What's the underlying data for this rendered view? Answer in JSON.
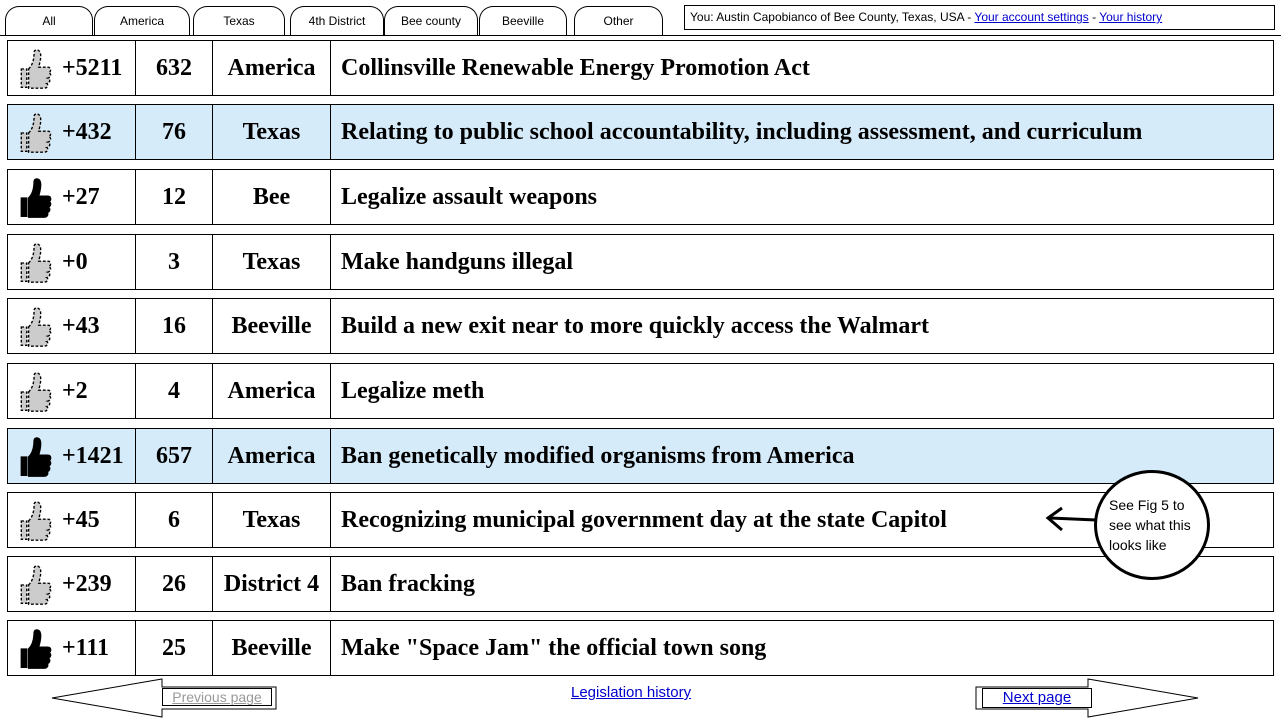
{
  "tabs": [
    "All",
    "America",
    "Texas",
    "4th District",
    "Bee county",
    "Beeville",
    "Other"
  ],
  "account": {
    "prefix": "You: Austin Capobianco of Bee County, Texas, USA - ",
    "settings_link": "Your account settings",
    "separator": " - ",
    "history_link": "Your history"
  },
  "rows": [
    {
      "score": "+5211",
      "count": "632",
      "region": "America",
      "title": "Collinsville Renewable Energy Promotion Act",
      "voted": false,
      "highlight": false
    },
    {
      "score": "+432",
      "count": "76",
      "region": "Texas",
      "title": "Relating to public school accountability, including assessment, and curriculum",
      "voted": false,
      "highlight": true
    },
    {
      "score": "+27",
      "count": "12",
      "region": "Bee",
      "title": "Legalize assault weapons",
      "voted": true,
      "highlight": false
    },
    {
      "score": "+0",
      "count": "3",
      "region": "Texas",
      "title": "Make handguns illegal",
      "voted": false,
      "highlight": false
    },
    {
      "score": "+43",
      "count": "16",
      "region": "Beeville",
      "title": "Build a new exit near to more quickly access the Walmart",
      "voted": false,
      "highlight": false
    },
    {
      "score": "+2",
      "count": "4",
      "region": "America",
      "title": "Legalize meth",
      "voted": false,
      "highlight": false
    },
    {
      "score": "+1421",
      "count": "657",
      "region": "America",
      "title": "Ban genetically modified organisms from America",
      "voted": true,
      "highlight": true
    },
    {
      "score": "+45",
      "count": "6",
      "region": "Texas",
      "title": "Recognizing municipal government day at the state Capitol",
      "voted": false,
      "highlight": false
    },
    {
      "score": "+239",
      "count": "26",
      "region": "District 4",
      "title": "Ban fracking",
      "voted": false,
      "highlight": false
    },
    {
      "score": "+111",
      "count": "25",
      "region": "Beeville",
      "title": "Make \"Space Jam\" the official town song",
      "voted": true,
      "highlight": false
    }
  ],
  "annotation": {
    "lines": [
      "See Fig 5 to",
      "see what this",
      "looks like"
    ]
  },
  "footer": {
    "previous": "Previous page",
    "history": "Legislation history",
    "next": "Next page"
  },
  "colors": {
    "highlight_row": "#d6ebfa",
    "link": "#0000cc",
    "disabled_link": "#999999",
    "thumb_inactive": "#cccccc",
    "thumb_active": "#000000"
  }
}
